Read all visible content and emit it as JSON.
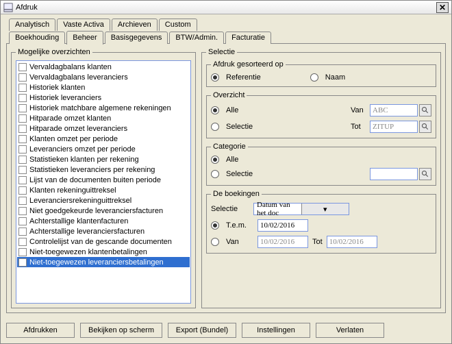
{
  "window": {
    "title": "Afdruk",
    "close_glyph": "✕"
  },
  "tabs_row1": [
    {
      "label": "Analytisch"
    },
    {
      "label": "Vaste Activa"
    },
    {
      "label": "Archieven"
    },
    {
      "label": "Custom"
    }
  ],
  "tabs_row2": [
    {
      "label": "Boekhouding"
    },
    {
      "label": "Beheer",
      "active": true
    },
    {
      "label": "Basisgegevens"
    },
    {
      "label": "BTW/Admin."
    },
    {
      "label": "Facturatie"
    }
  ],
  "left": {
    "legend": "Mogelijke overzichten",
    "items": [
      {
        "label": "Vervaldagbalans klanten"
      },
      {
        "label": "Vervaldagbalans leveranciers"
      },
      {
        "label": "Historiek klanten"
      },
      {
        "label": "Historiek leveranciers"
      },
      {
        "label": "Historiek matchbare algemene rekeningen"
      },
      {
        "label": "Hitparade omzet klanten"
      },
      {
        "label": "Hitparade omzet leveranciers"
      },
      {
        "label": "Klanten omzet per periode"
      },
      {
        "label": "Leveranciers omzet per periode"
      },
      {
        "label": "Statistieken klanten per rekening"
      },
      {
        "label": "Statistieken leveranciers per rekening"
      },
      {
        "label": "Lijst van de documenten buiten periode"
      },
      {
        "label": "Klanten rekeninguittreksel"
      },
      {
        "label": "Leveranciersrekeninguittreksel"
      },
      {
        "label": "Niet goedgekeurde leveranciersfacturen"
      },
      {
        "label": "Achterstallige klantenfacturen"
      },
      {
        "label": "Achterstallige leveranciersfacturen"
      },
      {
        "label": "Controlelijst van de gescande documenten"
      },
      {
        "label": "Niet-toegewezen klantenbetalingen"
      },
      {
        "label": "Niet-toegewezen leveranciersbetalingen",
        "selected": true
      }
    ]
  },
  "selection": {
    "legend": "Selectie",
    "sorted": {
      "legend": "Afdruk gesorteerd op",
      "option_ref": "Referentie",
      "option_name": "Naam",
      "value": "Referentie"
    },
    "overview": {
      "legend": "Overzicht",
      "option_all": "Alle",
      "option_sel": "Selectie",
      "value": "Alle",
      "van_label": "Van",
      "van_value": "ABC",
      "tot_label": "Tot",
      "tot_value": "ZITUP"
    },
    "category": {
      "legend": "Categorie",
      "option_all": "Alle",
      "option_sel": "Selectie",
      "value": "Alle",
      "sel_value": ""
    },
    "bookings": {
      "legend": "De boekingen",
      "sel_label": "Selectie",
      "combo_value": "Datum van het doc",
      "option_tem": "T.e.m.",
      "tem_value": "10/02/2016",
      "option_van": "Van",
      "van_value": "10/02/2016",
      "tot_label": "Tot",
      "tot_value": "10/02/2016",
      "value": "T.e.m."
    }
  },
  "buttons": {
    "print": "Afdrukken",
    "view": "Bekijken op scherm",
    "export": "Export (Bundel)",
    "settings": "Instellingen",
    "leave": "Verlaten"
  }
}
